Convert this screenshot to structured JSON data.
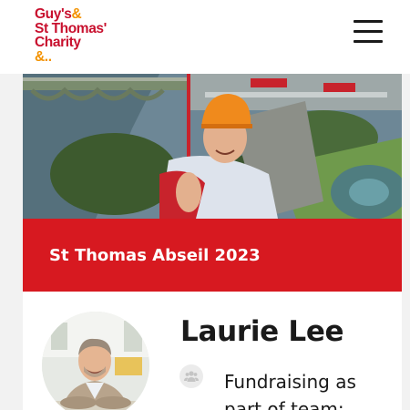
{
  "header": {
    "logo_lines": [
      "Guy's",
      "St Thomas'",
      "Charity",
      "&.."
    ],
    "logo_amp": "&",
    "menu_icon": "hamburger-menu-icon"
  },
  "event": {
    "title": "St Thomas Abseil 2023"
  },
  "fundraiser": {
    "name": "Laurie Lee",
    "team_icon": "team-people-icon",
    "status": "Fundraising as part of team:"
  },
  "colors": {
    "brand_red": "#d71920",
    "logo_red": "#c8102e",
    "logo_orange": "#f39200"
  }
}
